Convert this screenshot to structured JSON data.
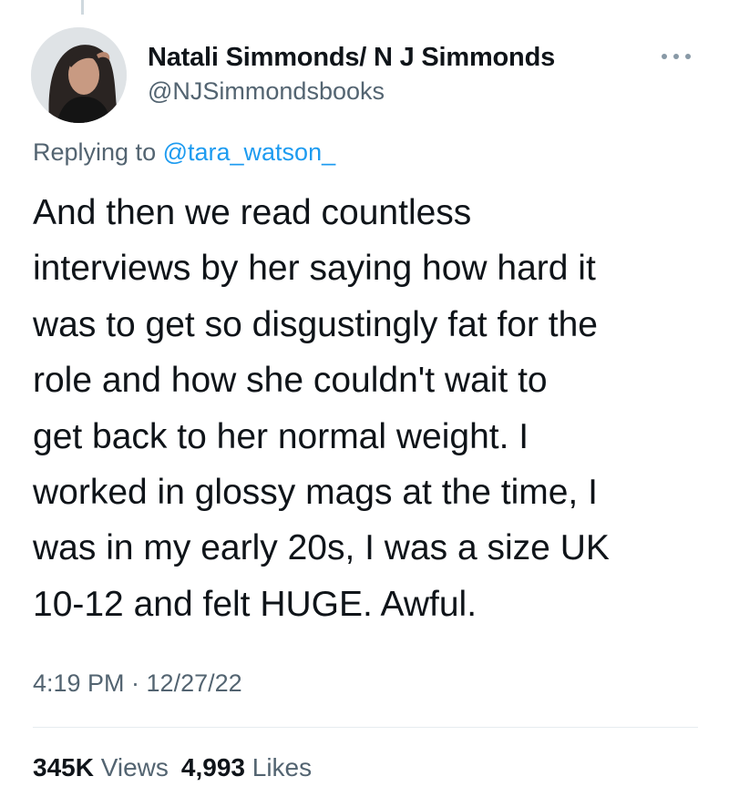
{
  "author": {
    "display_name": "Natali Simmonds/ N J Simmonds",
    "handle": "@NJSimmondsbooks"
  },
  "reply": {
    "prefix": "Replying to ",
    "to_handle": "@tara_watson_"
  },
  "tweet": {
    "text_lines": [
      "And then we read countless",
      "interviews by her saying how hard it",
      "was to get so disgustingly fat for the",
      "role and how she couldn't wait to",
      "get back to her normal weight. I",
      "worked in glossy mags at the time, I",
      "was in my early 20s, I was a size UK",
      "10-12 and felt HUGE. Awful."
    ],
    "timestamp": "4:19 PM · 12/27/22"
  },
  "stats": {
    "views_count": "345K",
    "views_label": "Views",
    "likes_count": "4,993",
    "likes_label": "Likes"
  },
  "icons": {
    "more": "more-horizontal-icon",
    "avatar": "avatar-photo"
  },
  "colors": {
    "link": "#1d9bf0",
    "secondary_text": "#536471",
    "primary_text": "#0f1419"
  }
}
